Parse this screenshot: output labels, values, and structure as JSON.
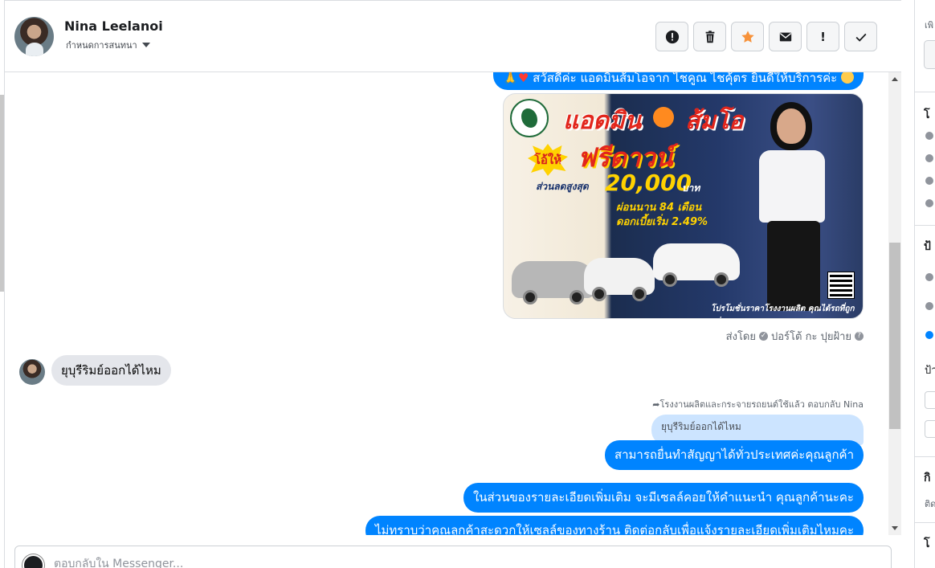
{
  "header": {
    "contact_name": "Nina Leelanoi",
    "assign_label": "กำหนดการสนทนา",
    "actions": [
      {
        "icon": "alert-circle-icon",
        "label": ""
      },
      {
        "icon": "trash-icon",
        "label": ""
      },
      {
        "icon": "star-icon",
        "label": ""
      },
      {
        "icon": "envelope-icon",
        "label": ""
      },
      {
        "icon": "exclamation-icon",
        "label": "!"
      },
      {
        "icon": "check-icon",
        "label": ""
      }
    ]
  },
  "messages": {
    "greeting_partial": "สวัสดีค่ะ แอดมินส้มโอจาก ไชคูณ ไชคุ้ตร ยินดีให้บริการค่ะ",
    "ad_image": {
      "title_left": "แอดมิน",
      "title_right": "ส้มโอ",
      "burst": "โอ้ให้",
      "headline": "ฟรีดาวน์",
      "discount_label": "ส่วนลดสูงสุด",
      "discount_value": "20,000",
      "discount_unit": "บาท",
      "installment": "ผ่อนนาน 84 เดือน",
      "interest": "ดอกเบี้ยเริ่ม 2.49%",
      "footer": "โปรโมชั่นราคาโรงงานผลิต คุณได้รถที่ถูกกว่า"
    },
    "sent_by_prefix": "ส่งโดย",
    "sent_by_name": "ปอร์โต้ กะ ปุยฝ้าย",
    "incoming_text": "ยุบุรีริมย์ออกได้ไหม",
    "reply_note": "โรงงานผลิตและกระจายรถยนต์ใช้แล้ว ตอบกลับ Nina",
    "quoted_text": "ยุบุรีริมย์ออกได้ไหม",
    "reply_1": "สามารถยื่นทำสัญญาได้ทั่วประเทศค่ะคุณลูกค้า",
    "reply_2": "ในส่วนของรายละเอียดเพิ่มเติม จะมีเซลล์คอยให้คำแนะนำ คุณลูกค้านะคะ",
    "reply_3": "ไม่ทราบว่าคุณลูกค้าสะดวกให้เซลล์ของทางร้าน ติดต่อกลับเพื่อแจ้งรายละเอียดเพิ่มเติมไหมคะ"
  },
  "composer": {
    "placeholder": "ตอบกลับใน Messenger..."
  },
  "right_panel": {
    "partial_1": "เพิ",
    "partial_2": "โ",
    "partial_3": "ป้",
    "partial_4": "ป้า",
    "partial_5": "กิ",
    "partial_6": "ติด",
    "partial_7": "โ"
  },
  "colors": {
    "accent": "#0084ff",
    "incoming_bubble": "#e4e6eb",
    "quoted_bubble": "#cce4ff",
    "star": "#f7923a"
  }
}
